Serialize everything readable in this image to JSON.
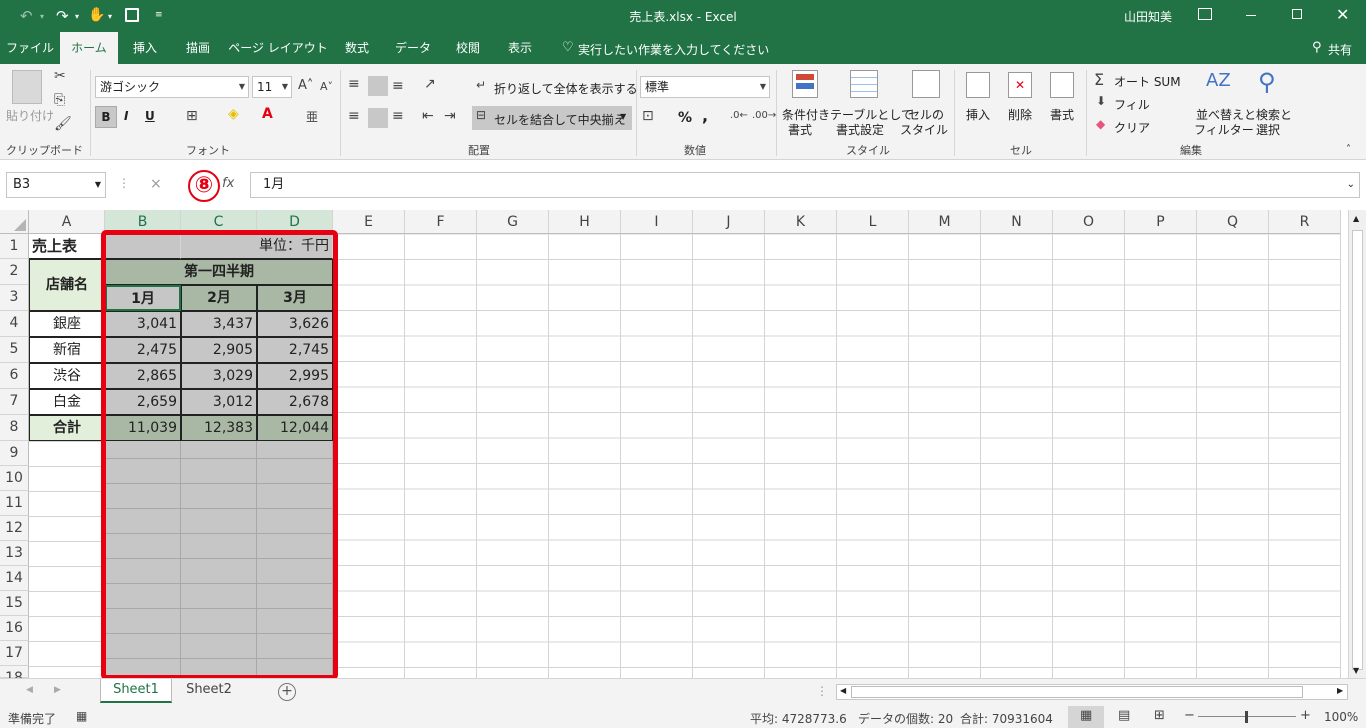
{
  "window": {
    "title": "売上表.xlsx  -  Excel",
    "user": "山田知美"
  },
  "tabs": [
    "ファイル",
    "ホーム",
    "挿入",
    "描画",
    "ページ レイアウト",
    "数式",
    "データ",
    "校閲",
    "表示"
  ],
  "tell_me": "実行したい作業を入力してください",
  "share": "共有",
  "ribbon": {
    "clipboard": {
      "paste": "貼り付け",
      "label": "クリップボード"
    },
    "font": {
      "name": "游ゴシック",
      "size": "11",
      "bold": "B",
      "italic": "I",
      "underline": "U",
      "label": "フォント"
    },
    "alignment": {
      "wrap": "折り返して全体を表示する",
      "merge": "セルを結合して中央揃え",
      "label": "配置"
    },
    "number": {
      "format": "標準",
      "percent": "%",
      "comma": ",",
      "label": "数値"
    },
    "styles": {
      "conditional": "条件付き",
      "conditional2": "書式",
      "table": "テーブルとして",
      "table2": "書式設定",
      "cell": "セルの",
      "cell2": "スタイル",
      "label": "スタイル"
    },
    "cells": {
      "insert": "挿入",
      "delete": "削除",
      "format": "書式",
      "label": "セル"
    },
    "editing": {
      "autosum": "オート SUM",
      "fill": "フィル",
      "clear": "クリア",
      "sort": "並べ替えと",
      "sort2": "フィルター",
      "find": "検索と",
      "find2": "選択",
      "label": "編集"
    }
  },
  "formula_bar": {
    "name_box": "B3",
    "value": "1月",
    "fx": "fx",
    "cancel": "×",
    "confirm": "✓"
  },
  "annotation": {
    "marker": "⑧"
  },
  "columns": [
    "A",
    "B",
    "C",
    "D",
    "E",
    "F",
    "G",
    "H",
    "I",
    "J",
    "K",
    "L",
    "M",
    "N",
    "O",
    "P",
    "Q",
    "R"
  ],
  "rows": [
    "1",
    "2",
    "3",
    "4",
    "5",
    "6",
    "7",
    "8",
    "9",
    "10",
    "11",
    "12",
    "13",
    "14",
    "15",
    "16",
    "17",
    "18"
  ],
  "cells": {
    "A1": "売上表",
    "C1": "単位：千円",
    "A2": "店舗名",
    "B2": "第一四半期",
    "B3": "1月",
    "C3": "2月",
    "D3": "3月",
    "A4": "銀座",
    "B4": "3,041",
    "C4": "3,437",
    "D4": "3,626",
    "A5": "新宿",
    "B5": "2,475",
    "C5": "2,905",
    "D5": "2,745",
    "A6": "渋谷",
    "B6": "2,865",
    "C6": "3,029",
    "D6": "2,995",
    "A7": "白金",
    "B7": "2,659",
    "C7": "3,012",
    "D7": "2,678",
    "A8": "合計",
    "B8": "11,039",
    "C8": "12,383",
    "D8": "12,044"
  },
  "sheets": {
    "s1": "Sheet1",
    "s2": "Sheet2",
    "add": "+"
  },
  "status": {
    "ready": "準備完了",
    "average": "平均: 4728773.6",
    "count": "データの個数: 20",
    "sum": "合計: 70931604",
    "zoom": "100%"
  },
  "colors": {
    "excel_green": "#217346",
    "highlight": "#e60012",
    "header_fill": "#a9b8a4",
    "selection_fill": "#c6c6c6",
    "store_fill": "#e2efda"
  }
}
